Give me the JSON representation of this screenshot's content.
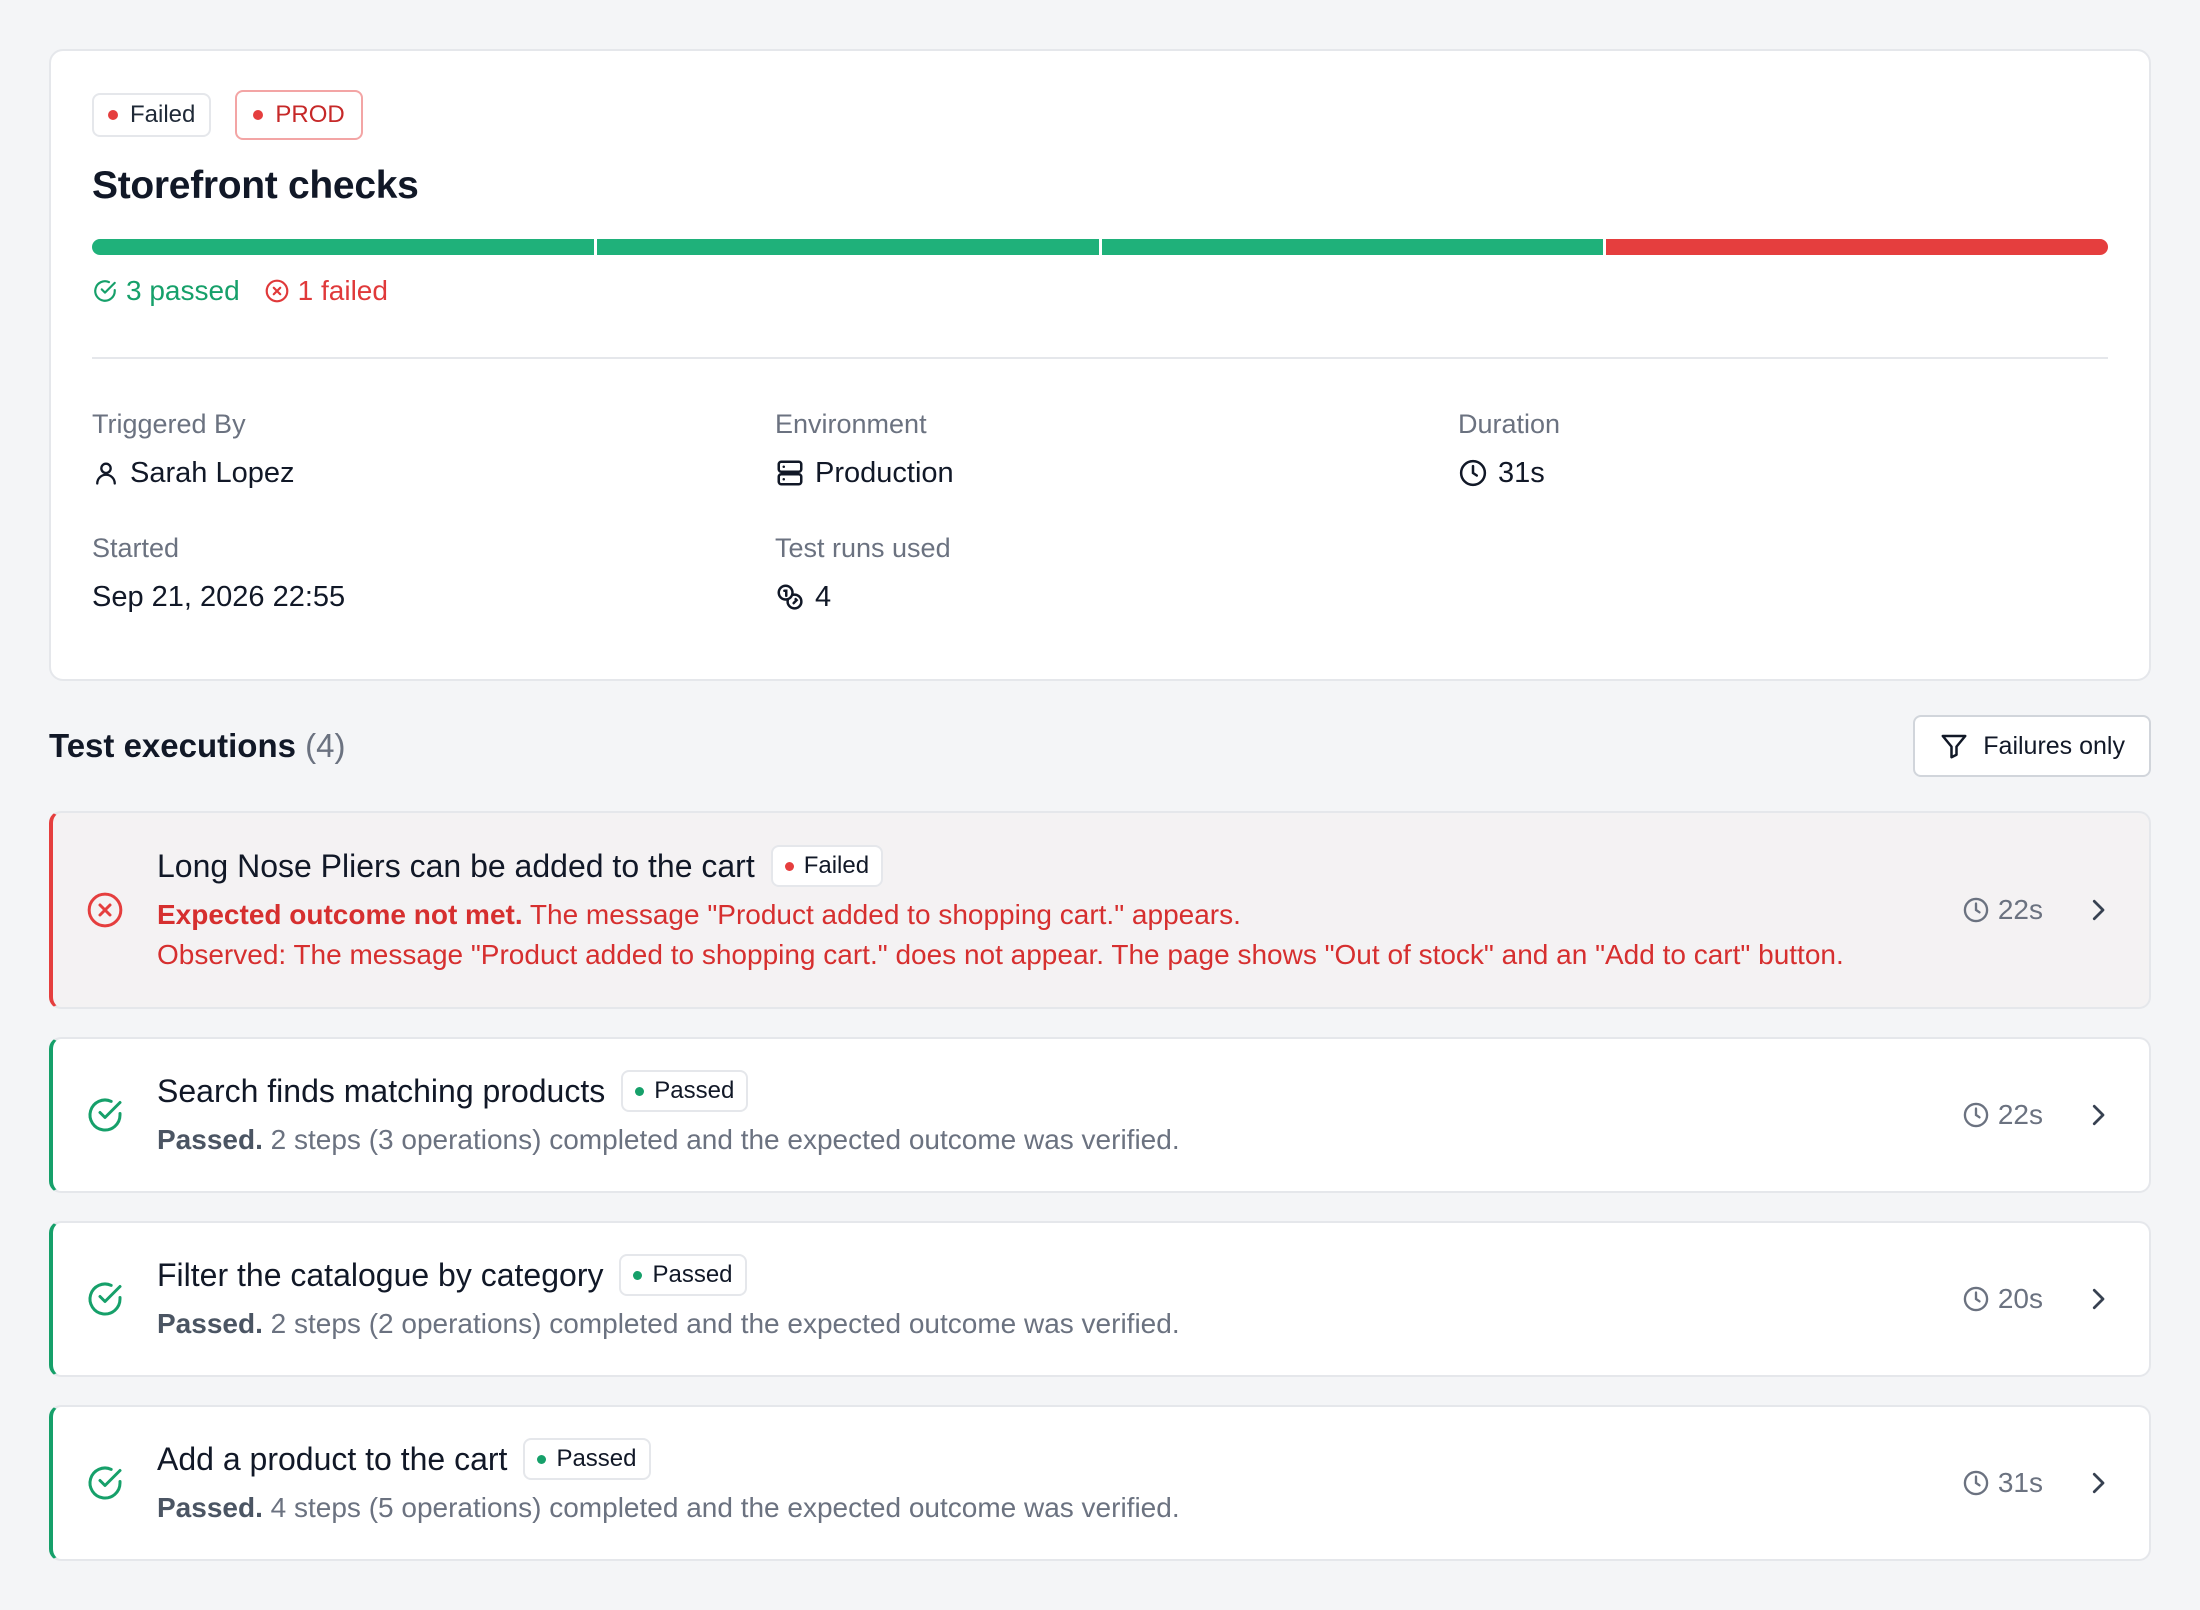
{
  "summary": {
    "status_badge": "Failed",
    "env_badge": "PROD",
    "title": "Storefront checks",
    "progress": {
      "passed": 3,
      "failed": 1
    },
    "passed_label": "3 passed",
    "failed_label": "1 failed",
    "meta": {
      "triggered_by_label": "Triggered By",
      "triggered_by_value": "Sarah Lopez",
      "environment_label": "Environment",
      "environment_value": "Production",
      "duration_label": "Duration",
      "duration_value": "31s",
      "started_label": "Started",
      "started_value": "Sep 21, 2026 22:55",
      "test_runs_label": "Test runs used",
      "test_runs_value": "4"
    }
  },
  "executions": {
    "title": "Test executions",
    "count": "(4)",
    "filter_label": "Failures only",
    "items": [
      {
        "name": "Long Nose Pliers can be added to the cart",
        "status": "Failed",
        "lead": "Expected outcome not met.",
        "text": "The message \"Product added to shopping cart.\" appears.",
        "observed": "Observed: The message \"Product added to shopping cart.\" does not appear. The page shows \"Out of stock\" and an \"Add to cart\" button.",
        "duration": "22s"
      },
      {
        "name": "Search finds matching products",
        "status": "Passed",
        "lead": "Passed.",
        "text": "2 steps (3 operations) completed and the expected outcome was verified.",
        "duration": "22s"
      },
      {
        "name": "Filter the catalogue by category",
        "status": "Passed",
        "lead": "Passed.",
        "text": "2 steps (2 operations) completed and the expected outcome was verified.",
        "duration": "20s"
      },
      {
        "name": "Add a product to the cart",
        "status": "Passed",
        "lead": "Passed.",
        "text": "4 steps (5 operations) completed and the expected outcome was verified.",
        "duration": "31s"
      }
    ]
  },
  "colors": {
    "pass": "#16a06a",
    "fail": "#e53e3e",
    "muted": "#6b7280"
  },
  "icons": [
    "check-circle-icon",
    "x-circle-icon",
    "user-icon",
    "server-icon",
    "clock-icon",
    "coins-icon",
    "filter-icon",
    "chevron-right-icon"
  ]
}
